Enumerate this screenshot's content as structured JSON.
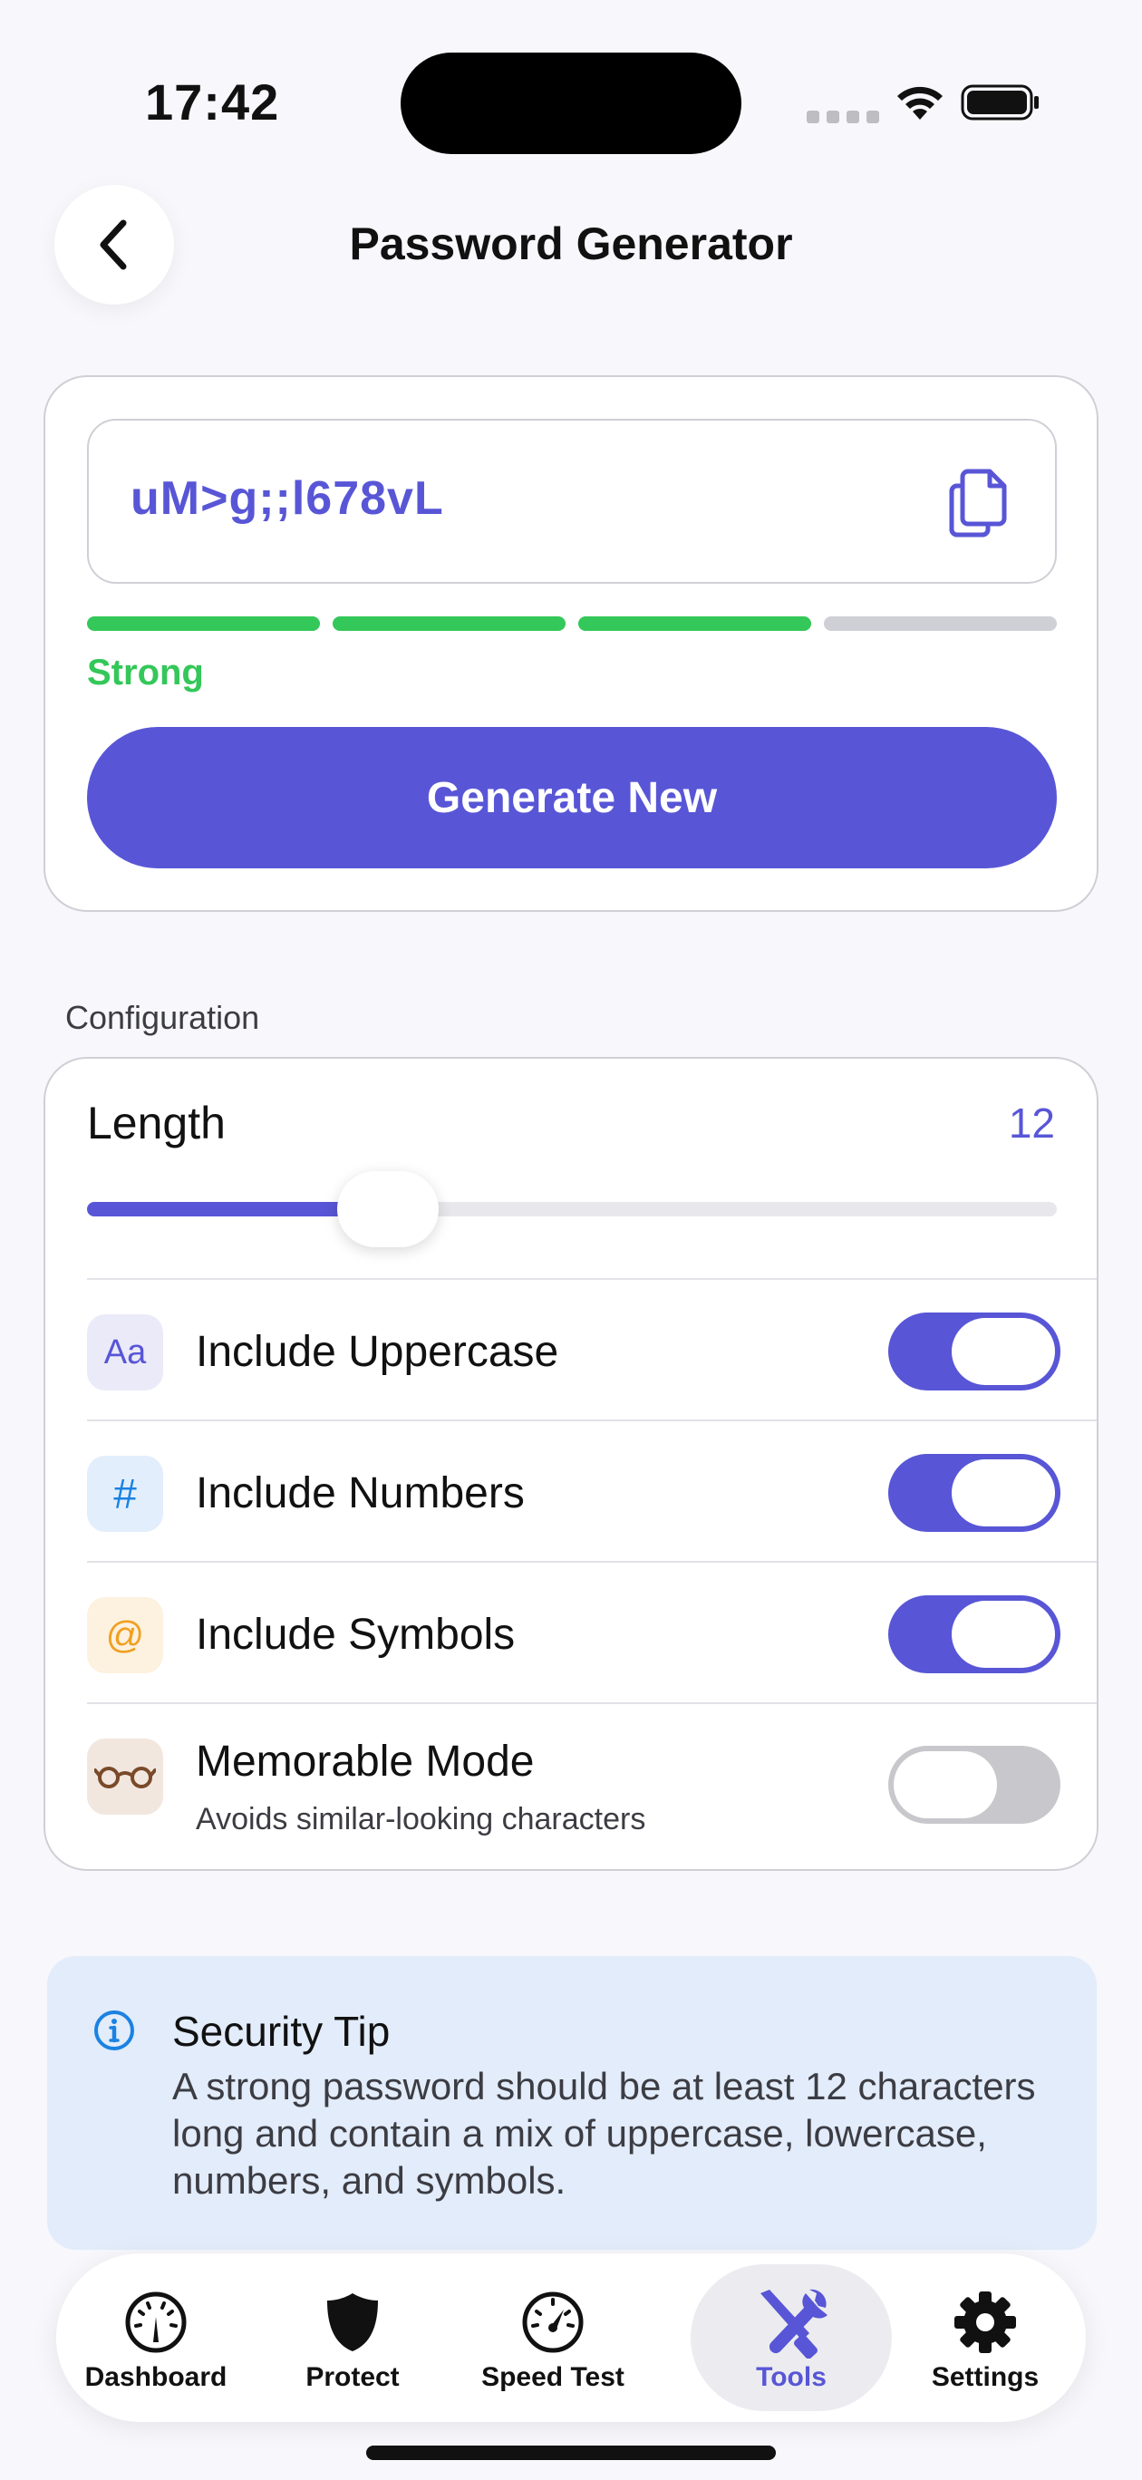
{
  "status_bar": {
    "time": "17:42"
  },
  "header": {
    "title": "Password Generator"
  },
  "password_card": {
    "password": "uM>g;;l678vL",
    "strength_label": "Strong",
    "strength_level": 3,
    "strength_max": 4,
    "generate_label": "Generate New",
    "colors": {
      "accent": "#5856d6",
      "strong": "#34c759"
    }
  },
  "configuration": {
    "section_label": "Configuration",
    "length_label": "Length",
    "length_value": "12",
    "length_fraction": 0.31,
    "options": [
      {
        "icon": "Aa",
        "icon_name": "text-case-icon",
        "label": "Include Uppercase",
        "enabled": true
      },
      {
        "icon": "#",
        "icon_name": "hash-icon",
        "label": "Include Numbers",
        "enabled": true
      },
      {
        "icon": "@",
        "icon_name": "at-sign-icon",
        "label": "Include Symbols",
        "enabled": true
      },
      {
        "icon_name": "glasses-icon",
        "label": "Memorable Mode",
        "sublabel": "Avoids similar-looking characters",
        "enabled": false
      }
    ]
  },
  "security_tip": {
    "title": "Security Tip",
    "body": "A strong password should be at least 12 characters long and contain a mix of uppercase, lowercase, numbers, and symbols."
  },
  "tab_bar": {
    "tabs": [
      {
        "label": "Dashboard",
        "icon_name": "gauge-icon",
        "active": false
      },
      {
        "label": "Protect",
        "icon_name": "shield-icon",
        "active": false
      },
      {
        "label": "Speed Test",
        "icon_name": "speedometer-icon",
        "active": false
      },
      {
        "label": "Tools",
        "icon_name": "tools-icon",
        "active": true
      },
      {
        "label": "Settings",
        "icon_name": "gear-icon",
        "active": false
      }
    ]
  }
}
